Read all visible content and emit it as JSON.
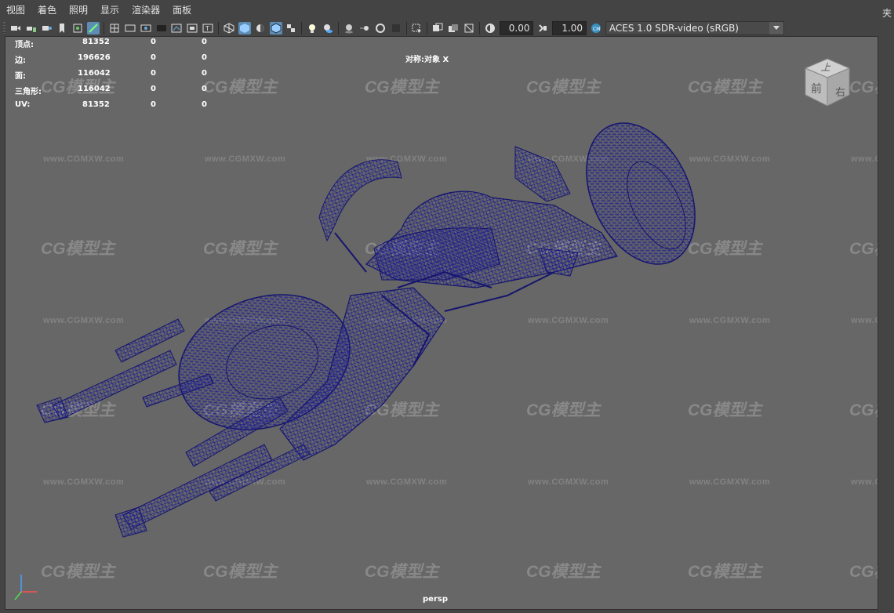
{
  "menubar": {
    "items": [
      {
        "label": "视图"
      },
      {
        "label": "着色"
      },
      {
        "label": "照明"
      },
      {
        "label": "显示"
      },
      {
        "label": "渲染器"
      },
      {
        "label": "面板"
      }
    ]
  },
  "toolbar": {
    "exposure_value": "0.00",
    "gamma_value": "1.00",
    "color_space": "ACES 1.0 SDR-video (sRGB)"
  },
  "hud": {
    "rows": [
      {
        "label": "顶点:",
        "count": "81352",
        "a": "0",
        "b": "0"
      },
      {
        "label": "边:",
        "count": "196626",
        "a": "0",
        "b": "0"
      },
      {
        "label": "面:",
        "count": "116042",
        "a": "0",
        "b": "0"
      },
      {
        "label": "三角形:",
        "count": "116042",
        "a": "0",
        "b": "0"
      },
      {
        "label": "UV:",
        "count": "81352",
        "a": "0",
        "b": "0"
      }
    ],
    "symmetry": "对称:对象 X"
  },
  "viewcube": {
    "top": "上",
    "front": "前",
    "right": "右"
  },
  "camera": "persp",
  "right_panel": {
    "label": "夹"
  },
  "watermark": {
    "logo_text": "CG模型主",
    "url": "www.CGMXW.com"
  },
  "colors": {
    "wireframe": "#1a1a8c",
    "viewport_bg": "#676767",
    "ui_bg": "#444444",
    "active_icon": "#5d8db4"
  },
  "icons": [
    "camera-icon",
    "camera-lock-icon",
    "camera-attributes-icon",
    "bookmark-icon",
    "image-plane-icon",
    "grease-pencil-icon",
    "grid-icon",
    "film-gate-icon",
    "resolution-gate-icon",
    "gate-mask-icon",
    "field-chart-icon",
    "safe-action-icon",
    "safe-title-icon",
    "wireframe-icon",
    "smooth-shade-icon",
    "default-lighting-icon",
    "wireframe-on-shaded-icon",
    "textured-icon",
    "use-all-lights-icon",
    "shadows-icon",
    "screen-space-ao-icon",
    "motion-blur-icon",
    "anti-aliasing-icon",
    "depth-of-field-icon",
    "isolate-select-icon",
    "xray-icon",
    "xray-joints-icon",
    "xray-active-icon",
    "backface-culling-icon",
    "exposure-icon",
    "gamma-icon",
    "color-management-icon"
  ]
}
